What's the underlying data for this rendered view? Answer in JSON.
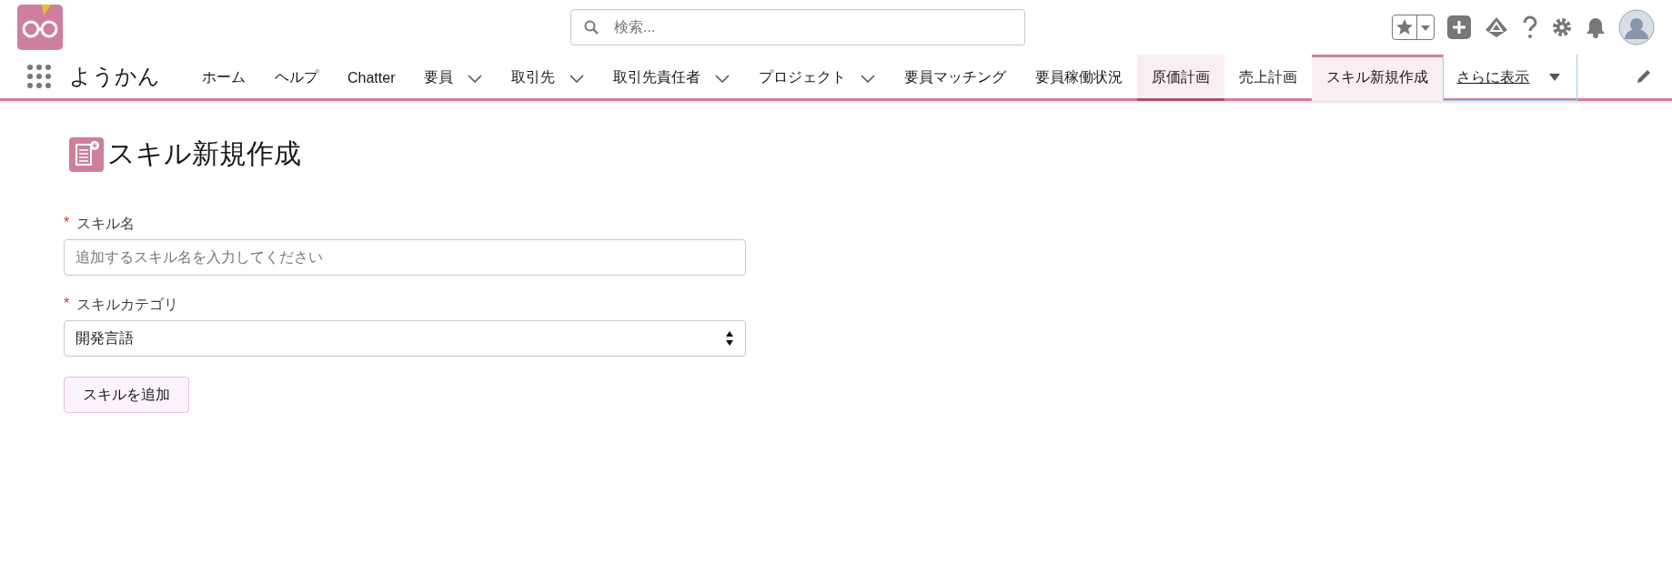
{
  "header": {
    "search": {
      "placeholder": "検索..."
    }
  },
  "nav": {
    "app_name": "ようかん",
    "tabs": [
      {
        "label": "ホーム",
        "has_menu": false,
        "selected": false,
        "highlighted": false
      },
      {
        "label": "ヘルプ",
        "has_menu": false,
        "selected": false,
        "highlighted": false
      },
      {
        "label": "Chatter",
        "has_menu": false,
        "selected": false,
        "highlighted": false
      },
      {
        "label": "要員",
        "has_menu": true,
        "selected": false,
        "highlighted": false
      },
      {
        "label": "取引先",
        "has_menu": true,
        "selected": false,
        "highlighted": false
      },
      {
        "label": "取引先責任者",
        "has_menu": true,
        "selected": false,
        "highlighted": false
      },
      {
        "label": "プロジェクト",
        "has_menu": true,
        "selected": false,
        "highlighted": false
      },
      {
        "label": "要員マッチング",
        "has_menu": false,
        "selected": false,
        "highlighted": false
      },
      {
        "label": "要員稼働状況",
        "has_menu": false,
        "selected": false,
        "highlighted": false
      },
      {
        "label": "原価計画",
        "has_menu": false,
        "selected": false,
        "highlighted": true
      },
      {
        "label": "売上計画",
        "has_menu": false,
        "selected": false,
        "highlighted": false
      },
      {
        "label": "スキル新規作成",
        "has_menu": false,
        "selected": true,
        "highlighted": false
      }
    ],
    "more": {
      "label": "さらに表示",
      "focused": true
    }
  },
  "page": {
    "title": "スキル新規作成",
    "fields": [
      {
        "kind": "text",
        "label": "スキル名",
        "required": true,
        "required_mark": "*",
        "placeholder": "追加するスキル名を入力してください"
      },
      {
        "kind": "select",
        "label": "スキルカテゴリ",
        "required": true,
        "required_mark": "*",
        "value": "開発言語"
      }
    ],
    "submit": "スキルを追加"
  }
}
